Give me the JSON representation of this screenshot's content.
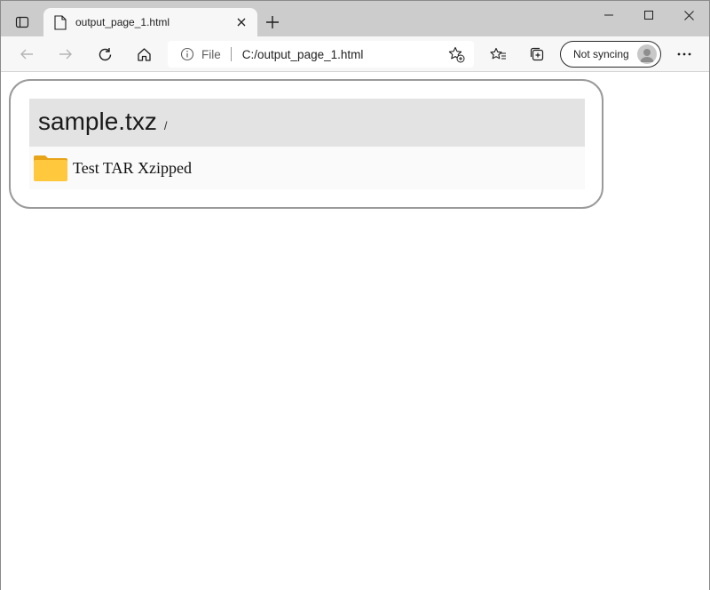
{
  "browser": {
    "tab": {
      "title": "output_page_1.html"
    },
    "address": {
      "scheme": "File",
      "url": "C:/output_page_1.html"
    },
    "profile": {
      "status": "Not syncing"
    },
    "icons": {
      "tab_actions": "tab-actions-icon",
      "file": "file-icon",
      "close_tab": "close-icon",
      "new_tab": "plus-icon",
      "minimize": "minimize-icon",
      "maximize": "maximize-icon",
      "close_window": "close-icon",
      "back": "back-arrow-icon",
      "forward": "forward-arrow-icon",
      "refresh": "refresh-icon",
      "home": "home-icon",
      "info": "info-icon",
      "add_favorite": "star-add-icon",
      "favorites": "favorites-icon",
      "collections": "collections-icon",
      "more": "more-icon"
    }
  },
  "page": {
    "title": "sample.txz",
    "path": "/",
    "entries": [
      {
        "icon": "folder-icon",
        "label": "Test TAR Xzipped",
        "color": "#ffc83d"
      }
    ]
  }
}
